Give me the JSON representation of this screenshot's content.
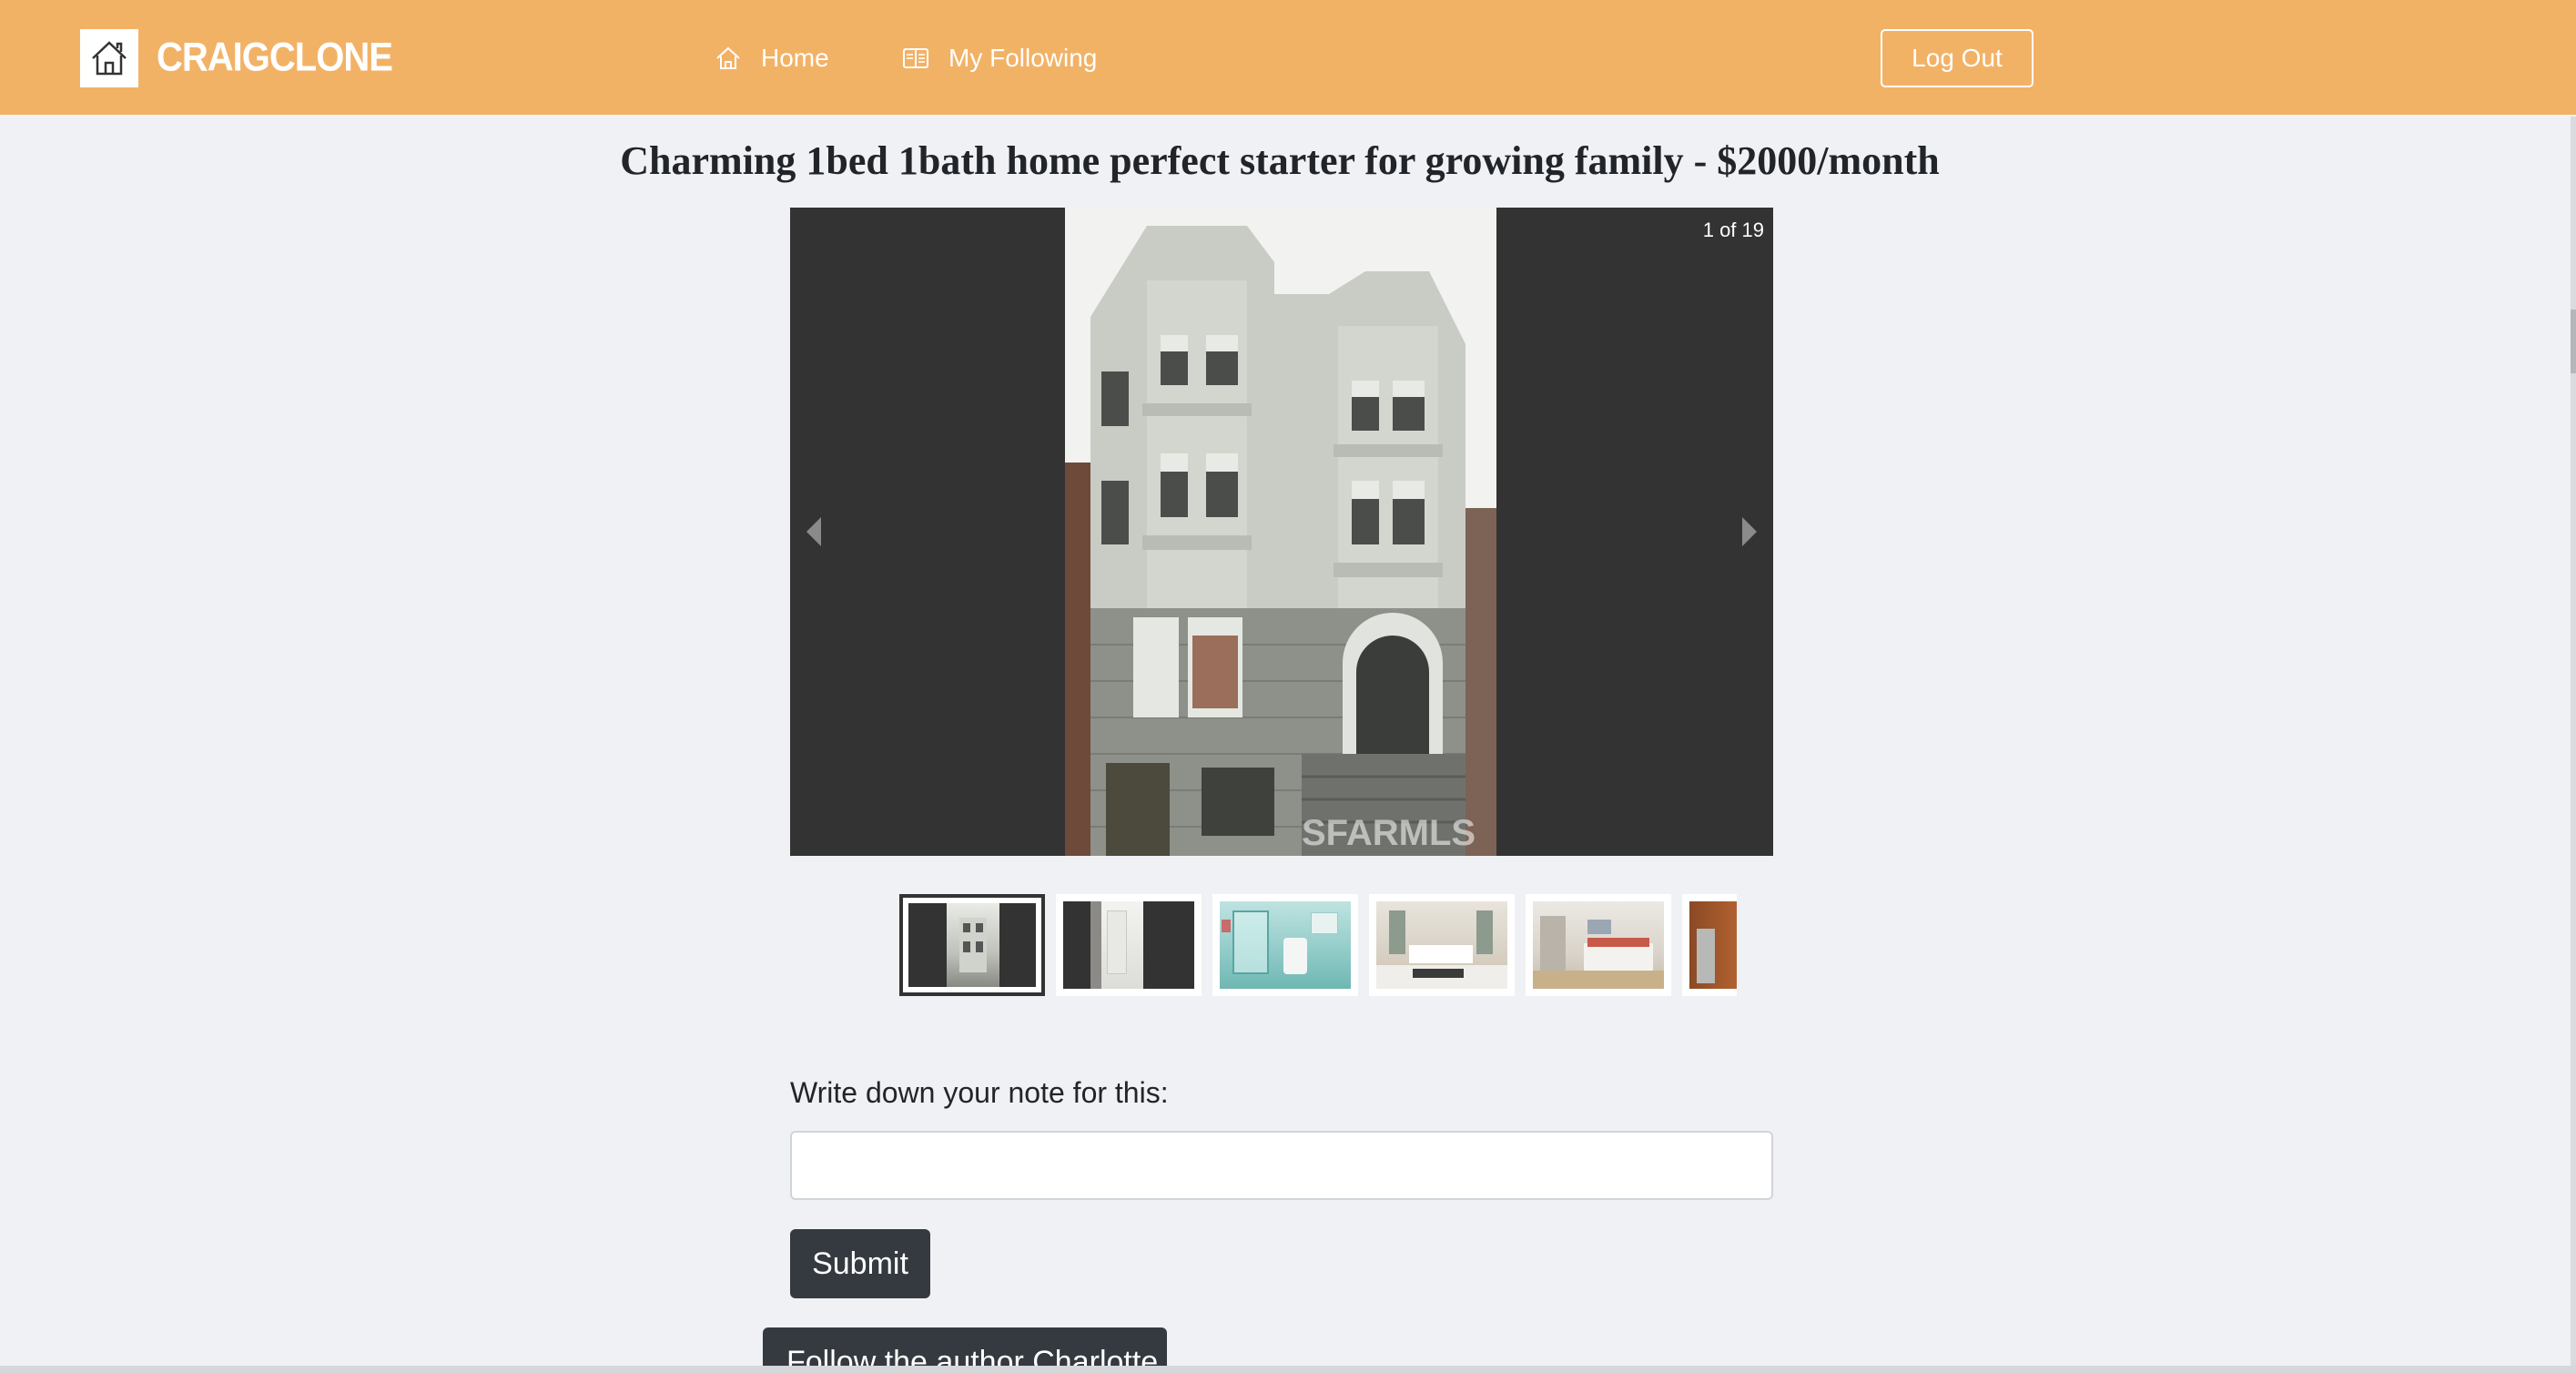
{
  "brand": {
    "name": "CRAIGCLONE",
    "logo_icon": "house-icon"
  },
  "nav": {
    "home_label": "Home",
    "following_label": "My Following",
    "home_icon": "home-outline-icon",
    "following_icon": "list-card-icon"
  },
  "header": {
    "logout_label": "Log Out"
  },
  "listing": {
    "title": "Charming 1bed 1bath home perfect starter for growing family - $2000/month"
  },
  "carousel": {
    "counter": "1 of 19",
    "total_slides": 19,
    "active_slide": 1,
    "watermark": "SFARMLS"
  },
  "thumbnails": [
    {
      "name": "building-exterior",
      "selected": true
    },
    {
      "name": "kitchen-fridge",
      "selected": false
    },
    {
      "name": "bathroom-shower",
      "selected": false
    },
    {
      "name": "living-room",
      "selected": false
    },
    {
      "name": "bedroom",
      "selected": false
    },
    {
      "name": "kitchen-cabinets",
      "selected": false
    }
  ],
  "note_form": {
    "label": "Write down your note for this:",
    "input_value": "",
    "input_placeholder": "",
    "submit_label": "Submit"
  },
  "follow": {
    "label": "Follow the author Charlotte"
  },
  "colors": {
    "navbar": "#f2b266",
    "page_bg": "#f0f1f5",
    "dark_button": "#343a40",
    "carousel_bg": "#333333"
  }
}
